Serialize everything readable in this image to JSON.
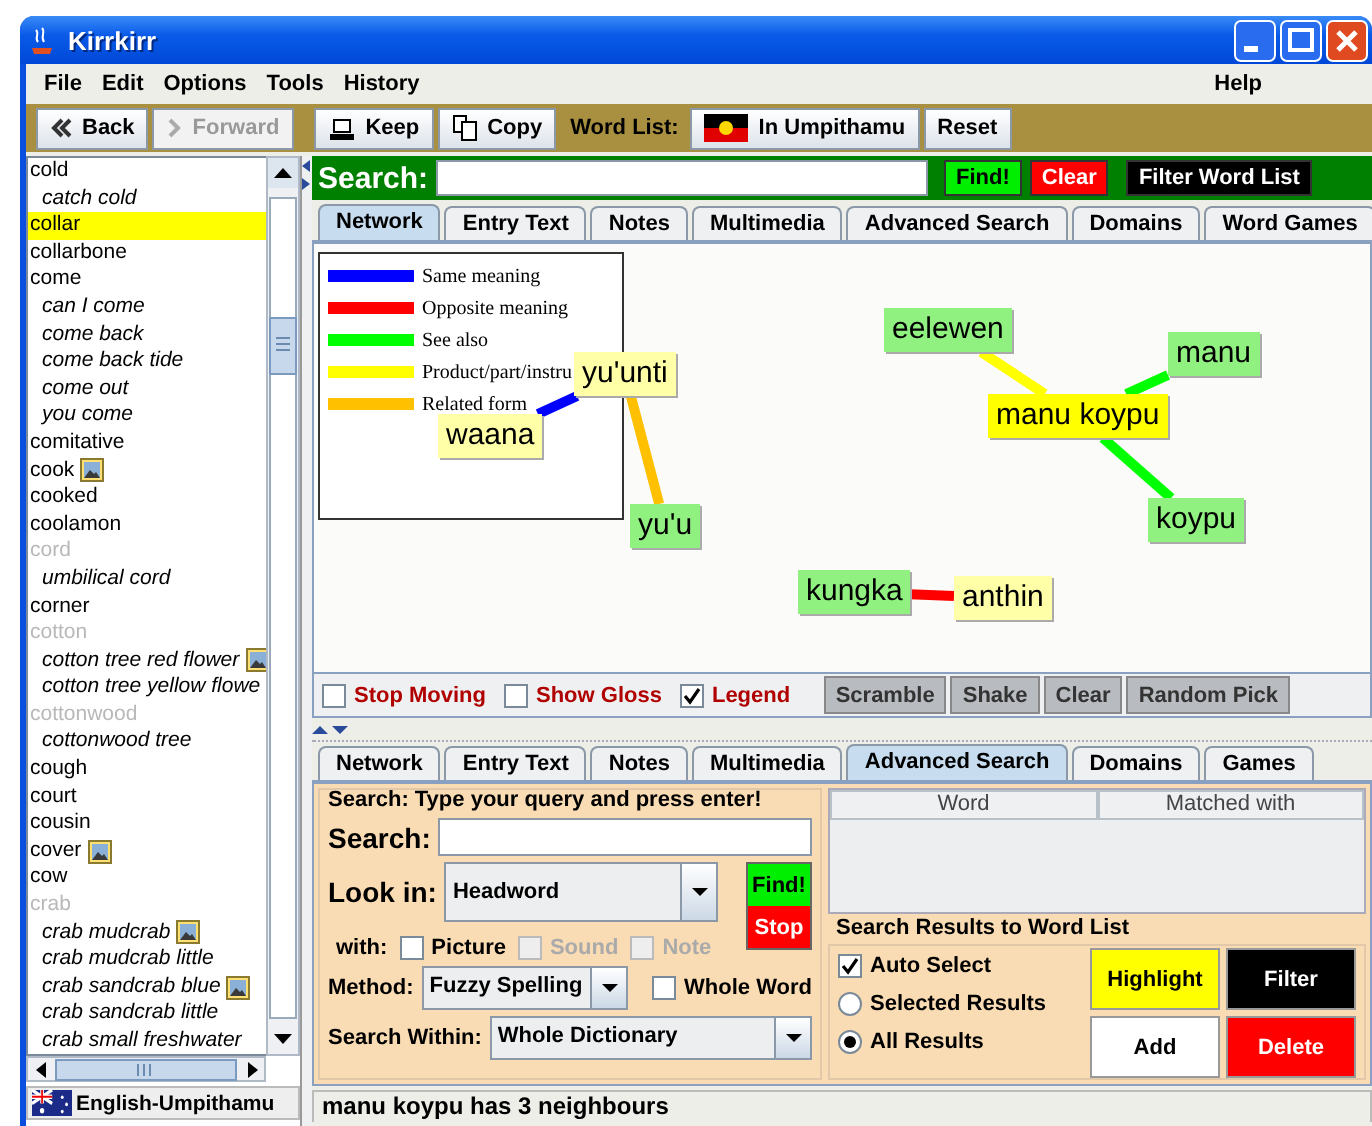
{
  "window": {
    "title": "Kirrkirr"
  },
  "menu": {
    "left": [
      "File",
      "Edit",
      "Options",
      "Tools",
      "History"
    ],
    "right": [
      "Help"
    ]
  },
  "toolbar": {
    "back": {
      "label": "Back",
      "disabled": false
    },
    "forward": {
      "label": "Forward",
      "disabled": true
    },
    "keep": "Keep",
    "copy": "Copy",
    "word_list_label": "Word List:",
    "word_list_button": "In Umpithamu",
    "reset": "Reset"
  },
  "word_list": {
    "items": [
      {
        "text": "cold",
        "kind": "headword",
        "selected": false,
        "greyed": false,
        "picture": false
      },
      {
        "text": "catch cold",
        "kind": "subentry",
        "selected": false,
        "greyed": false,
        "picture": false
      },
      {
        "text": "collar",
        "kind": "headword",
        "selected": true,
        "greyed": false,
        "picture": false
      },
      {
        "text": "collarbone",
        "kind": "headword",
        "selected": false,
        "greyed": false,
        "picture": false
      },
      {
        "text": "come",
        "kind": "headword",
        "selected": false,
        "greyed": false,
        "picture": false
      },
      {
        "text": "can I come",
        "kind": "subentry",
        "selected": false,
        "greyed": false,
        "picture": false
      },
      {
        "text": "come back",
        "kind": "subentry",
        "selected": false,
        "greyed": false,
        "picture": false
      },
      {
        "text": "come back tide",
        "kind": "subentry",
        "selected": false,
        "greyed": false,
        "picture": false
      },
      {
        "text": "come out",
        "kind": "subentry",
        "selected": false,
        "greyed": false,
        "picture": false
      },
      {
        "text": "you come",
        "kind": "subentry",
        "selected": false,
        "greyed": false,
        "picture": false
      },
      {
        "text": "comitative",
        "kind": "headword",
        "selected": false,
        "greyed": false,
        "picture": false
      },
      {
        "text": "cook",
        "kind": "headword",
        "selected": false,
        "greyed": false,
        "picture": true
      },
      {
        "text": "cooked",
        "kind": "headword",
        "selected": false,
        "greyed": false,
        "picture": false
      },
      {
        "text": "coolamon",
        "kind": "headword",
        "selected": false,
        "greyed": false,
        "picture": false
      },
      {
        "text": "cord",
        "kind": "headword",
        "selected": false,
        "greyed": true,
        "picture": false
      },
      {
        "text": "umbilical cord",
        "kind": "subentry",
        "selected": false,
        "greyed": false,
        "picture": false
      },
      {
        "text": "corner",
        "kind": "headword",
        "selected": false,
        "greyed": false,
        "picture": false
      },
      {
        "text": "cotton",
        "kind": "headword",
        "selected": false,
        "greyed": true,
        "picture": false
      },
      {
        "text": "cotton tree red flower",
        "kind": "subentry",
        "selected": false,
        "greyed": false,
        "picture": true
      },
      {
        "text": "cotton tree yellow flowe",
        "kind": "subentry",
        "selected": false,
        "greyed": false,
        "picture": false
      },
      {
        "text": "cottonwood",
        "kind": "headword",
        "selected": false,
        "greyed": true,
        "picture": false
      },
      {
        "text": "cottonwood tree",
        "kind": "subentry",
        "selected": false,
        "greyed": false,
        "picture": false
      },
      {
        "text": "cough",
        "kind": "headword",
        "selected": false,
        "greyed": false,
        "picture": false
      },
      {
        "text": "court",
        "kind": "headword",
        "selected": false,
        "greyed": false,
        "picture": false
      },
      {
        "text": "cousin",
        "kind": "headword",
        "selected": false,
        "greyed": false,
        "picture": false
      },
      {
        "text": "cover",
        "kind": "headword",
        "selected": false,
        "greyed": false,
        "picture": true
      },
      {
        "text": "cow",
        "kind": "headword",
        "selected": false,
        "greyed": false,
        "picture": false
      },
      {
        "text": "crab",
        "kind": "headword",
        "selected": false,
        "greyed": true,
        "picture": false
      },
      {
        "text": "crab mudcrab",
        "kind": "subentry",
        "selected": false,
        "greyed": false,
        "picture": true
      },
      {
        "text": "crab mudcrab little",
        "kind": "subentry",
        "selected": false,
        "greyed": false,
        "picture": false
      },
      {
        "text": "crab sandcrab blue",
        "kind": "subentry",
        "selected": false,
        "greyed": false,
        "picture": true
      },
      {
        "text": "crab sandcrab little",
        "kind": "subentry",
        "selected": false,
        "greyed": false,
        "picture": false
      },
      {
        "text": "crab small freshwater",
        "kind": "subentry",
        "selected": false,
        "greyed": false,
        "picture": false
      }
    ],
    "language": "English-Umpithamu"
  },
  "search_bar": {
    "label": "Search:",
    "find": "Find!",
    "clear": "Clear",
    "filter": "Filter Word List"
  },
  "top_tabs": [
    {
      "label": "Network",
      "selected": true
    },
    {
      "label": "Entry Text",
      "selected": false
    },
    {
      "label": "Notes",
      "selected": false
    },
    {
      "label": "Multimedia",
      "selected": false
    },
    {
      "label": "Advanced Search",
      "selected": false
    },
    {
      "label": "Domains",
      "selected": false
    },
    {
      "label": "Word Games",
      "selected": false
    }
  ],
  "network": {
    "legend": [
      {
        "label": "Same meaning",
        "color": "#0000ff"
      },
      {
        "label": "Opposite meaning",
        "color": "#ff0000"
      },
      {
        "label": "See also",
        "color": "#00ff00"
      },
      {
        "label": "Product/part/instru",
        "color": "#ffff00"
      },
      {
        "label": "Related form",
        "color": "#ffc000"
      }
    ],
    "groups": [
      {
        "hub": {
          "text": "yu'unti",
          "color": "#ffffa8"
        },
        "links": [
          {
            "node": {
              "text": "waana",
              "color": "#ffffa8"
            },
            "color": "#0000ff"
          },
          {
            "node": {
              "text": "yu'u",
              "color": "#90f080"
            },
            "color": "#ffc000"
          }
        ]
      },
      {
        "hub": {
          "text": "manu koypu",
          "color": "#ffff00"
        },
        "links": [
          {
            "node": {
              "text": "eelewen",
              "color": "#90f080"
            },
            "color": "#ffff00"
          },
          {
            "node": {
              "text": "manu",
              "color": "#90f080"
            },
            "color": "#00ff00"
          },
          {
            "node": {
              "text": "koypu",
              "color": "#90f080"
            },
            "color": "#00ff00"
          }
        ]
      },
      {
        "hub": {
          "text": "kungka",
          "color": "#90f080"
        },
        "links": [
          {
            "node": {
              "text": "anthin",
              "color": "#ffffa8"
            },
            "color": "#ff0000"
          }
        ]
      }
    ],
    "checkboxes": [
      {
        "label": "Stop Moving",
        "checked": false
      },
      {
        "label": "Show Gloss",
        "checked": false
      },
      {
        "label": "Legend",
        "checked": true
      }
    ],
    "buttons": [
      "Scramble",
      "Shake",
      "Clear",
      "Random Pick"
    ]
  },
  "bottom_tabs": [
    {
      "label": "Network",
      "selected": false
    },
    {
      "label": "Entry Text",
      "selected": false
    },
    {
      "label": "Notes",
      "selected": false
    },
    {
      "label": "Multimedia",
      "selected": false
    },
    {
      "label": "Advanced Search",
      "selected": true
    },
    {
      "label": "Domains",
      "selected": false
    },
    {
      "label": "Games",
      "selected": false
    }
  ],
  "advanced_search": {
    "heading": "Search: Type your query and press enter!",
    "search_label": "Search:",
    "look_in_label": "Look in:",
    "look_in": "Headword",
    "find": "Find!",
    "stop": "Stop",
    "with_label": "with:",
    "with_options": [
      {
        "label": "Picture",
        "checked": false,
        "disabled": false
      },
      {
        "label": "Sound",
        "checked": false,
        "disabled": true
      },
      {
        "label": "Note",
        "checked": false,
        "disabled": true
      }
    ],
    "method_label": "Method:",
    "method": "Fuzzy Spelling",
    "whole_word": {
      "label": "Whole Word",
      "checked": false
    },
    "search_within_label": "Search Within:",
    "search_within": "Whole Dictionary",
    "results_columns": [
      "Word",
      "Matched with"
    ],
    "results_group": "Search Results to Word List",
    "auto_select": {
      "label": "Auto Select",
      "checked": true
    },
    "radios": [
      {
        "label": "Selected Results",
        "selected": false
      },
      {
        "label": "All Results",
        "selected": true
      }
    ],
    "buttons": [
      "Highlight",
      "Filter",
      "Add",
      "Delete"
    ]
  },
  "status": "manu koypu has 3 neighbours"
}
